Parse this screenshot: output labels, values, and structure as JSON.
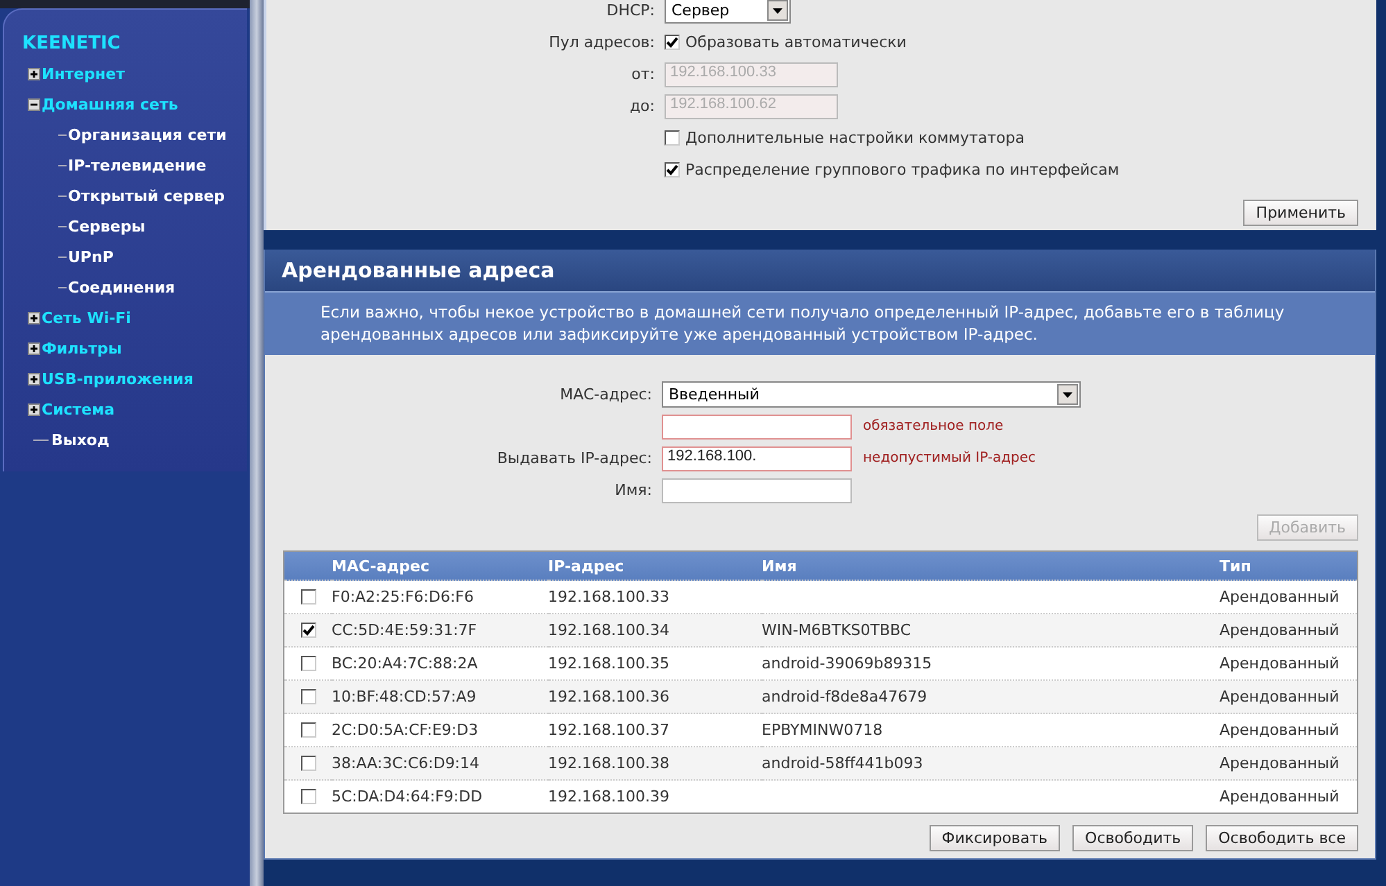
{
  "sidebar": {
    "brand": "KEENETIC",
    "items": [
      {
        "label": "Интернет",
        "kind": "group",
        "expanded": false
      },
      {
        "label": "Домашняя сеть",
        "kind": "group",
        "expanded": true,
        "children": [
          {
            "label": "Организация сети"
          },
          {
            "label": "IP-телевидение"
          },
          {
            "label": "Открытый сервер"
          },
          {
            "label": "Серверы"
          },
          {
            "label": "UPnP"
          },
          {
            "label": "Соединения"
          }
        ]
      },
      {
        "label": "Сеть Wi-Fi",
        "kind": "group",
        "expanded": false
      },
      {
        "label": "Фильтры",
        "kind": "group",
        "expanded": false
      },
      {
        "label": "USB-приложения",
        "kind": "group",
        "expanded": false
      },
      {
        "label": "Система",
        "kind": "group",
        "expanded": false
      },
      {
        "label": "Выход",
        "kind": "link"
      }
    ]
  },
  "settings": {
    "dhcp": {
      "label": "DHCP:",
      "value": "Сервер"
    },
    "pool": {
      "label": "Пул адресов:",
      "option": "Образовать автоматически",
      "checked": true
    },
    "range": [
      {
        "label": "от:",
        "value": "192.168.100.33",
        "disabled": true
      },
      {
        "label": "до:",
        "value": "192.168.100.62",
        "disabled": true
      }
    ],
    "options": [
      {
        "label": "Дополнительные настройки коммутатора",
        "checked": false
      },
      {
        "label": "Распределение группового трафика по интерфейсам",
        "checked": true
      }
    ],
    "apply_button": "Применить"
  },
  "leases": {
    "title": "Арендованные адреса",
    "description": "Если важно, чтобы некое устройство в домашней сети получало определенный IP-адрес, добавьте его в таблицу арендованных адресов или зафиксируйте уже арендованный устройством IP-адрес.",
    "mac": {
      "label": "MAC-адрес:",
      "value": "Введенный"
    },
    "mac_input": {
      "error": "обязательное поле"
    },
    "ip": {
      "label": "Выдавать IP-адрес:",
      "value": "192.168.100.",
      "error": "недопустимый IP-адрес"
    },
    "name": {
      "label": "Имя:"
    },
    "add_button": {
      "label": "Добавить",
      "disabled": true
    },
    "table": {
      "columns": [
        "MAC-адрес",
        "IP-адрес",
        "Имя",
        "Тип"
      ],
      "rows": [
        {
          "checked": false,
          "mac": "F0:A2:25:F6:D6:F6",
          "ip": "192.168.100.33",
          "type": "Арендованный"
        },
        {
          "checked": true,
          "mac": "CC:5D:4E:59:31:7F",
          "ip": "192.168.100.34",
          "name": "WIN-M6BTKS0TBBC",
          "type": "Арендованный"
        },
        {
          "checked": false,
          "mac": "BC:20:A4:7C:88:2A",
          "ip": "192.168.100.35",
          "name": "android-39069b89315",
          "type": "Арендованный"
        },
        {
          "checked": false,
          "mac": "10:BF:48:CD:57:A9",
          "ip": "192.168.100.36",
          "name": "android-f8de8a47679",
          "type": "Арендованный"
        },
        {
          "checked": false,
          "mac": "2C:D0:5A:CF:E9:D3",
          "ip": "192.168.100.37",
          "name": "EPBYMINW0718",
          "type": "Арендованный"
        },
        {
          "checked": false,
          "mac": "38:AA:3C:C6:D9:14",
          "ip": "192.168.100.38",
          "name": "android-58ff441b093",
          "type": "Арендованный"
        },
        {
          "checked": false,
          "mac": "5C:DA:D4:64:F9:DD",
          "ip": "192.168.100.39",
          "type": "Арендованный"
        }
      ]
    },
    "buttons": [
      "Фиксировать",
      "Освободить",
      "Освободить все"
    ]
  }
}
